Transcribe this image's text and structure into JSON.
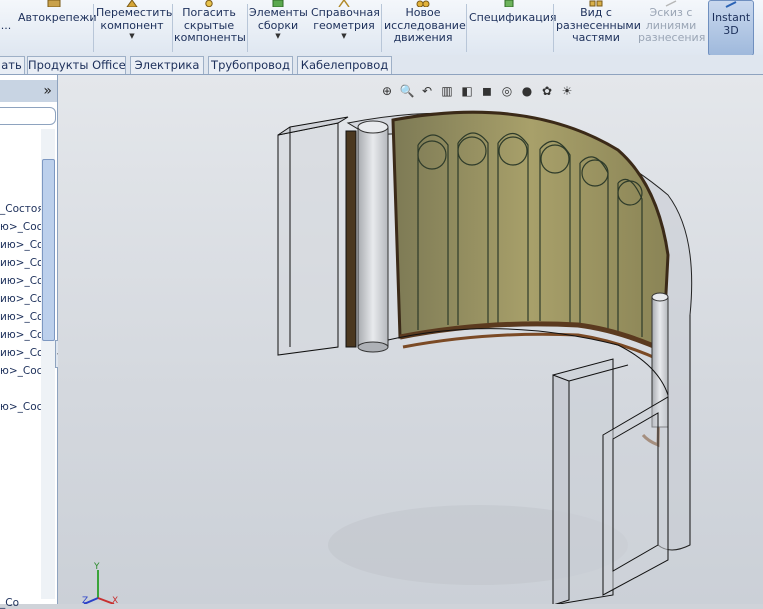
{
  "ribbon": {
    "left_trunc": "...",
    "buttons": [
      {
        "label": "Автокрепежи"
      },
      {
        "label": "Переместить компонент"
      },
      {
        "label": "Погасить скрытые компоненты"
      },
      {
        "label": "Элементы сборки"
      },
      {
        "label": "Справочная геометрия"
      },
      {
        "label": "Новое исследование движения"
      },
      {
        "label": "Спецификация"
      },
      {
        "label": "Вид с разнесенными частями"
      },
      {
        "label": "Эскиз с линиями разнесения"
      },
      {
        "label": "Instant 3D"
      }
    ]
  },
  "tabs": [
    "ать",
    "Продукты Office",
    "Электрика",
    "Трубопровод",
    "Кабелепровод"
  ],
  "tree": {
    "items": [
      "_Состоян",
      "ю>_Состо",
      "ию>_Со",
      "ию>_Со",
      "ию>_Со",
      "ию>_Со",
      "ию>_Со",
      "ию>_Со",
      "ию>_Со",
      "ю>_Сост",
      "ю>_Сост"
    ],
    "bottom_item": "_Со"
  },
  "hud_icons": [
    "zoom-to-fit-icon",
    "zoom-area-icon",
    "previous-view-icon",
    "section-view-icon",
    "view-orientation-icon",
    "display-style-icon",
    "hide-show-icon",
    "edit-appearance-icon",
    "apply-scene-icon",
    "view-settings-icon"
  ],
  "triad": {
    "x": "X",
    "y": "Y",
    "z": "Z"
  }
}
